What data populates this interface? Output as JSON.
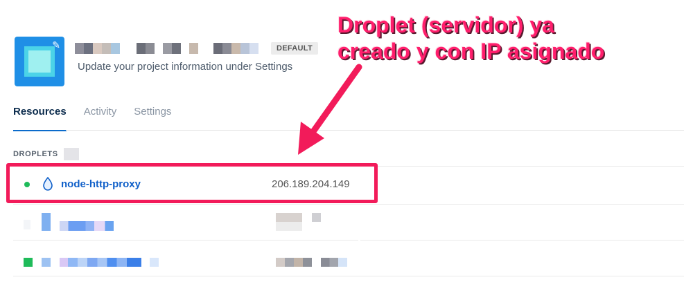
{
  "project": {
    "badge": "DEFAULT",
    "description": "Update your project information under Settings",
    "icon_name": "project-cube-icon"
  },
  "tabs": [
    {
      "label": "Resources",
      "active": true
    },
    {
      "label": "Activity",
      "active": false
    },
    {
      "label": "Settings",
      "active": false
    }
  ],
  "droplets": {
    "section_label": "DROPLETS",
    "items": [
      {
        "name": "node-http-proxy",
        "ip": "206.189.204.149",
        "status_color": "#1fbb5a"
      }
    ]
  },
  "annotation": {
    "line1": "Droplet (servidor) ya",
    "line2": "creado y con IP asignado",
    "color": "#ff1e6c"
  }
}
